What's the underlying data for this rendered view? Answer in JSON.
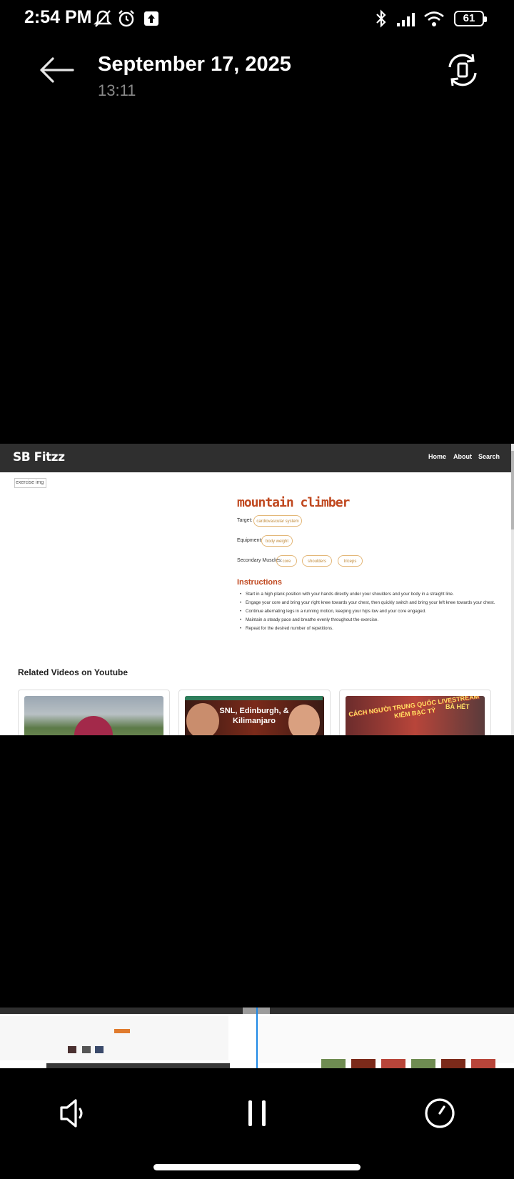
{
  "status_bar": {
    "time": "2:54 PM",
    "battery": "61"
  },
  "header": {
    "date": "September 17, 2025",
    "time": "13:11"
  },
  "site": {
    "logo": "SB Fitzz",
    "nav": [
      "Home",
      "About",
      "Search"
    ],
    "image_alt": "exercise img",
    "exercise": {
      "name": "mountain climber",
      "target_label": "Target:",
      "target": "cardiovascular system",
      "equipment_label": "Equipment:",
      "equipment": "body weight",
      "secondary_label": "Secondary Muscles:",
      "secondary": [
        "core",
        "shoulders",
        "triceps"
      ],
      "instructions_title": "Instructions",
      "instructions": [
        "Start in a high plank position with your hands directly under your shoulders and your body in a straight line.",
        "Engage your core and bring your right knee towards your chest, then quickly switch and bring your left knee towards your chest.",
        "Continue alternating legs in a running motion, keeping your hips low and your core engaged.",
        "Maintain a steady pace and breathe evenly throughout the exercise.",
        "Repeat for the desired number of repetitions."
      ]
    },
    "related_title": "Related Videos on Youtube",
    "videos": [
      {
        "thumb_text": ""
      },
      {
        "thumb_text": "SNL, Edinburgh, & Kilimanjaro"
      },
      {
        "thumb_text": "CÁCH NGƯỜI TRUNG QUỐC LIVESTREAM KIẾM BẠC TỶ",
        "badge": "BÀ HẾT"
      }
    ]
  },
  "colors": {
    "accent": "#c0481f",
    "pill": "#e3b778",
    "nav_bg": "#2f2f2f",
    "playhead": "#1e88e5"
  },
  "icons": [
    "back-arrow-icon",
    "rotate-icon",
    "volume-icon",
    "pause-icon",
    "speed-icon"
  ]
}
